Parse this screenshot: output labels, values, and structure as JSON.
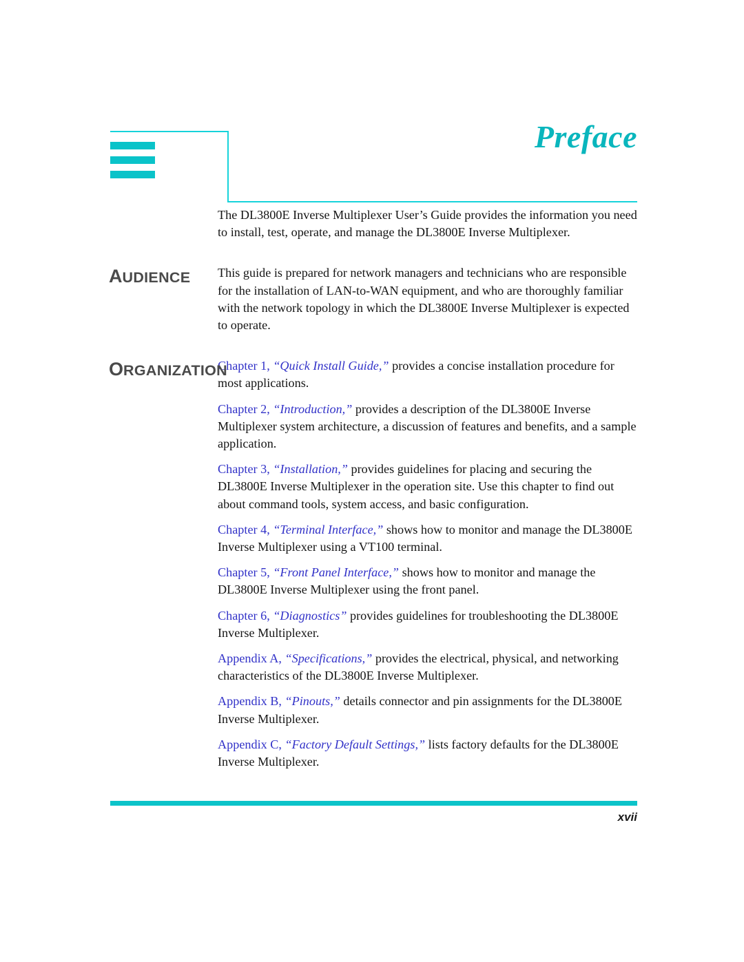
{
  "document": {
    "title": "Preface",
    "page_number": "xvii"
  },
  "intro": {
    "paragraph": "The DL3800E Inverse Multiplexer User’s Guide provides the information you need to install, test, operate, and manage the DL3800E Inverse Multiplexer."
  },
  "sections": [
    {
      "heading_first_letter": "A",
      "heading_rest": "UDIENCE",
      "heading_full": "AUDIENCE",
      "paragraphs": [
        "This guide is prepared for network managers and technicians who are responsible for the installation of LAN-to-WAN equipment, and who are thoroughly familiar with the network topology in which the DL3800E Inverse Multiplexer is expected to operate."
      ]
    },
    {
      "heading_first_letter": "O",
      "heading_rest": "RGANIZATION",
      "heading_full": "ORGANIZATION",
      "entries": [
        {
          "ref_label": "Chapter 1, ",
          "ref_title": "“Quick Install Guide,”",
          "description": " provides a concise installation procedure for most applications."
        },
        {
          "ref_label": "Chapter 2, ",
          "ref_title": "“Introduction,”",
          "description": "  provides a description of the DL3800E Inverse Multiplexer system architecture, a discussion of features and benefits, and a sample application."
        },
        {
          "ref_label": "Chapter 3, ",
          "ref_title": "“Installation,”",
          "description": "  provides guidelines for placing and securing the DL3800E Inverse Multiplexer in the operation site. Use this chapter to find out about command tools, system access, and basic configuration."
        },
        {
          "ref_label": "Chapter 4, ",
          "ref_title": "“Terminal Interface,”",
          "description": "  shows how to monitor and manage the DL3800E Inverse Multiplexer using a VT100 terminal."
        },
        {
          "ref_label": "Chapter 5, ",
          "ref_title": "“Front Panel Interface,”",
          "description": " shows how to monitor and manage the DL3800E Inverse Multiplexer using the front panel."
        },
        {
          "ref_label": "Chapter 6, ",
          "ref_title": "“Diagnostics”",
          "description": "  provides guidelines for troubleshooting the DL3800E Inverse Multiplexer."
        },
        {
          "ref_label": "Appendix A, ",
          "ref_title": "“Specifications,”",
          "description": " provides the electrical, physical, and networking characteristics of the DL3800E Inverse Multiplexer."
        },
        {
          "ref_label": "Appendix B, ",
          "ref_title": "“Pinouts,”",
          "description": " details connector and pin assignments for the DL3800E Inverse Multiplexer."
        },
        {
          "ref_label": "Appendix C, ",
          "ref_title": "“Factory Default Settings,”",
          "description": "  lists factory defaults for the DL3800E Inverse Multiplexer."
        }
      ]
    }
  ],
  "colors": {
    "accent_teal": "#0ac3c9",
    "rule_teal": "#16d3da",
    "title_teal": "#0ab6bd",
    "heading_gray": "#4a4a4a",
    "xref_blue": "#3232c8",
    "body_black": "#151515"
  }
}
